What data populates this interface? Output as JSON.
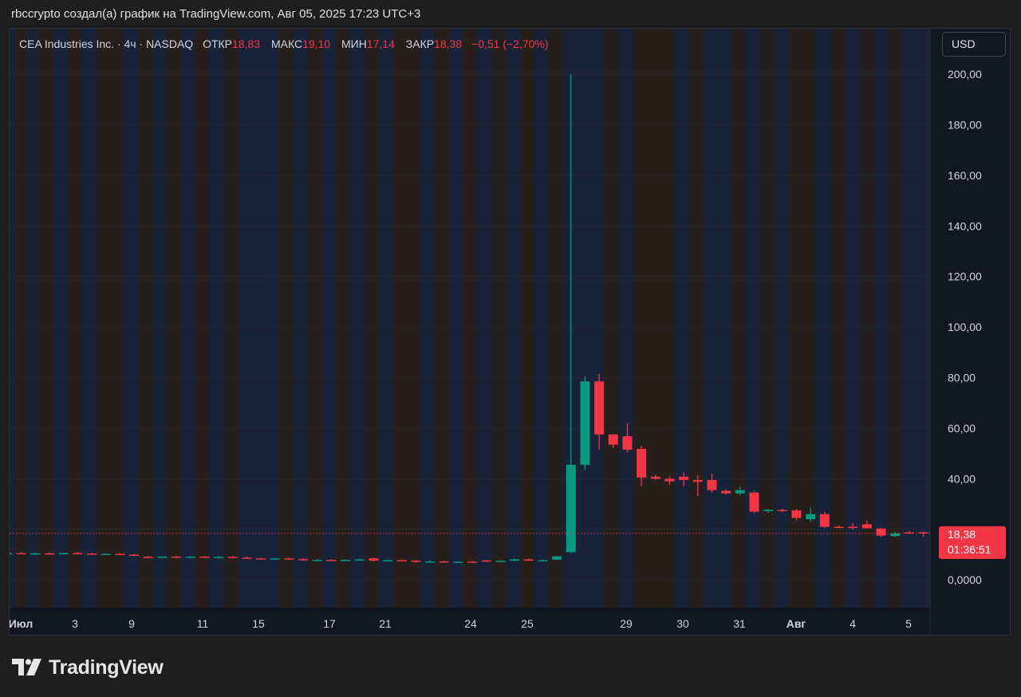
{
  "caption": "rbccrypto создал(а) график на TradingView.com, Авг 05, 2025 17:23 UTC+3",
  "legend": {
    "symbol": "CEA Industries Inc.",
    "interval": "4ч",
    "exchange": "NASDAQ",
    "open_label": "ОТКР",
    "open": "18,83",
    "high_label": "МАКС",
    "high": "19,10",
    "low_label": "МИН",
    "low": "17,14",
    "close_label": "ЗАКР",
    "close": "18,38",
    "change": "−0,51 (−2,70%)"
  },
  "currency": "USD",
  "brand": "TradingView",
  "price_tag": {
    "price": "18,38",
    "countdown": "01:36:51"
  },
  "colors": {
    "up": "#089981",
    "down": "#f23645",
    "background": "#131722",
    "session_blue": "#182339",
    "session_brown": "#261f1c"
  },
  "chart_data": {
    "type": "candlestick",
    "title": "CEA Industries Inc. · 4ч · NASDAQ",
    "ylim": [
      -11,
      218
    ],
    "y_ticks": [
      0,
      20,
      40,
      60,
      80,
      100,
      120,
      140,
      160,
      180,
      200
    ],
    "y_tick_labels": [
      "0,0000",
      "",
      "40,00",
      "60,00",
      "80,00",
      "100,00",
      "120,00",
      "140,00",
      "160,00",
      "180,00",
      "200,00"
    ],
    "x_tick_labels": [
      "Июл",
      "3",
      "9",
      "11",
      "15",
      "17",
      "21",
      "24",
      "25",
      "29",
      "30",
      "31",
      "Авг",
      "4",
      "5"
    ],
    "last_price": 18.38,
    "candles": [
      {
        "o": 10.5,
        "h": 10.9,
        "l": 10.2,
        "c": 10.6
      },
      {
        "o": 10.6,
        "h": 10.9,
        "l": 10.3,
        "c": 10.4
      },
      {
        "o": 10.4,
        "h": 10.7,
        "l": 10.0,
        "c": 10.5
      },
      {
        "o": 10.5,
        "h": 10.8,
        "l": 10.2,
        "c": 10.3
      },
      {
        "o": 10.3,
        "h": 10.7,
        "l": 10.1,
        "c": 10.6
      },
      {
        "o": 10.6,
        "h": 11.0,
        "l": 10.3,
        "c": 10.4
      },
      {
        "o": 10.4,
        "h": 10.7,
        "l": 10.0,
        "c": 10.2
      },
      {
        "o": 10.2,
        "h": 10.5,
        "l": 9.9,
        "c": 10.3
      },
      {
        "o": 10.3,
        "h": 10.6,
        "l": 9.8,
        "c": 10.0
      },
      {
        "o": 10.0,
        "h": 10.3,
        "l": 9.4,
        "c": 9.6
      },
      {
        "o": 9.1,
        "h": 9.5,
        "l": 8.7,
        "c": 8.9
      },
      {
        "o": 8.9,
        "h": 9.3,
        "l": 8.6,
        "c": 9.2
      },
      {
        "o": 9.2,
        "h": 9.5,
        "l": 8.8,
        "c": 9.0
      },
      {
        "o": 9.0,
        "h": 9.4,
        "l": 8.6,
        "c": 9.2
      },
      {
        "o": 9.2,
        "h": 9.5,
        "l": 8.6,
        "c": 8.7
      },
      {
        "o": 8.7,
        "h": 9.3,
        "l": 8.5,
        "c": 9.1
      },
      {
        "o": 9.1,
        "h": 9.4,
        "l": 8.7,
        "c": 8.8
      },
      {
        "o": 8.8,
        "h": 9.2,
        "l": 8.4,
        "c": 8.5
      },
      {
        "o": 8.5,
        "h": 8.8,
        "l": 8.1,
        "c": 8.3
      },
      {
        "o": 8.3,
        "h": 8.7,
        "l": 8.0,
        "c": 8.5
      },
      {
        "o": 8.5,
        "h": 8.8,
        "l": 8.1,
        "c": 8.2
      },
      {
        "o": 8.2,
        "h": 8.6,
        "l": 7.6,
        "c": 7.8
      },
      {
        "o": 7.8,
        "h": 8.2,
        "l": 7.5,
        "c": 7.9
      },
      {
        "o": 7.9,
        "h": 8.2,
        "l": 7.6,
        "c": 7.7
      },
      {
        "o": 7.7,
        "h": 8.1,
        "l": 7.5,
        "c": 7.9
      },
      {
        "o": 7.9,
        "h": 8.3,
        "l": 7.6,
        "c": 8.1
      },
      {
        "o": 8.5,
        "h": 8.8,
        "l": 7.2,
        "c": 7.6
      },
      {
        "o": 7.6,
        "h": 8.0,
        "l": 7.3,
        "c": 7.8
      },
      {
        "o": 7.8,
        "h": 8.1,
        "l": 7.5,
        "c": 7.6
      },
      {
        "o": 7.6,
        "h": 8.0,
        "l": 6.9,
        "c": 7.2
      },
      {
        "o": 7.2,
        "h": 7.6,
        "l": 6.9,
        "c": 7.3
      },
      {
        "o": 7.3,
        "h": 7.6,
        "l": 6.9,
        "c": 7.0
      },
      {
        "o": 7.0,
        "h": 7.4,
        "l": 6.8,
        "c": 7.2
      },
      {
        "o": 7.2,
        "h": 7.5,
        "l": 6.9,
        "c": 7.1
      },
      {
        "o": 7.7,
        "h": 8.0,
        "l": 7.1,
        "c": 7.4
      },
      {
        "o": 7.4,
        "h": 7.8,
        "l": 7.1,
        "c": 7.6
      },
      {
        "o": 7.6,
        "h": 8.4,
        "l": 7.3,
        "c": 8.1
      },
      {
        "o": 8.1,
        "h": 8.5,
        "l": 7.4,
        "c": 7.6
      },
      {
        "o": 7.6,
        "h": 8.0,
        "l": 7.3,
        "c": 7.8
      },
      {
        "o": 8.0,
        "h": 9.5,
        "l": 7.8,
        "c": 9.3
      },
      {
        "o": 11.0,
        "h": 200.0,
        "l": 10.5,
        "c": 45.5
      },
      {
        "o": 45.5,
        "h": 80.5,
        "l": 43.5,
        "c": 78.5
      },
      {
        "o": 78.5,
        "h": 81.5,
        "l": 51.5,
        "c": 57.5
      },
      {
        "o": 57.5,
        "h": 57.8,
        "l": 52.0,
        "c": 53.5
      },
      {
        "o": 56.8,
        "h": 62.0,
        "l": 50.5,
        "c": 51.5
      },
      {
        "o": 51.8,
        "h": 53.0,
        "l": 37.0,
        "c": 40.5
      },
      {
        "o": 40.8,
        "h": 41.5,
        "l": 39.5,
        "c": 40.0
      },
      {
        "o": 40.0,
        "h": 41.0,
        "l": 37.5,
        "c": 39.0
      },
      {
        "o": 40.8,
        "h": 42.5,
        "l": 37.0,
        "c": 39.5
      },
      {
        "o": 39.5,
        "h": 41.5,
        "l": 33.0,
        "c": 38.8
      },
      {
        "o": 39.5,
        "h": 42.0,
        "l": 34.5,
        "c": 35.5
      },
      {
        "o": 35.2,
        "h": 35.8,
        "l": 33.8,
        "c": 34.2
      },
      {
        "o": 34.2,
        "h": 36.8,
        "l": 33.5,
        "c": 35.5
      },
      {
        "o": 34.5,
        "h": 35.2,
        "l": 26.5,
        "c": 27.0
      },
      {
        "o": 27.2,
        "h": 28.0,
        "l": 26.5,
        "c": 27.7
      },
      {
        "o": 27.7,
        "h": 28.2,
        "l": 26.8,
        "c": 27.5
      },
      {
        "o": 27.5,
        "h": 28.0,
        "l": 23.5,
        "c": 24.5
      },
      {
        "o": 24.0,
        "h": 28.5,
        "l": 23.0,
        "c": 26.0
      },
      {
        "o": 26.0,
        "h": 27.0,
        "l": 20.5,
        "c": 21.0
      },
      {
        "o": 21.0,
        "h": 21.6,
        "l": 20.5,
        "c": 20.8
      },
      {
        "o": 21.0,
        "h": 22.5,
        "l": 19.8,
        "c": 20.6
      },
      {
        "o": 22.0,
        "h": 23.5,
        "l": 20.2,
        "c": 20.4
      },
      {
        "o": 20.3,
        "h": 20.6,
        "l": 17.0,
        "c": 17.5
      },
      {
        "o": 17.3,
        "h": 19.0,
        "l": 17.0,
        "c": 18.4
      },
      {
        "o": 18.8,
        "h": 19.3,
        "l": 18.1,
        "c": 18.5
      },
      {
        "o": 18.83,
        "h": 19.1,
        "l": 17.14,
        "c": 18.38
      }
    ]
  }
}
